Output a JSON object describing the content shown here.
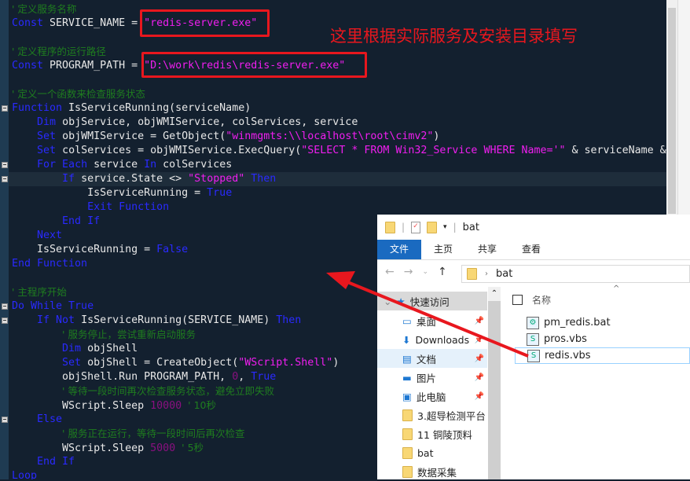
{
  "annotation": {
    "note": "这里根据实际服务及安装目录填写",
    "color": "#e8171e"
  },
  "code": [
    [
      [
        "cm",
        "' 定义服务名称"
      ]
    ],
    [
      [
        "kw",
        "Const"
      ],
      [
        "id",
        " SERVICE_NAME = "
      ],
      [
        "str",
        "\"redis-server.exe\""
      ]
    ],
    [],
    [
      [
        "cm",
        "' 定义程序的运行路径"
      ]
    ],
    [
      [
        "kw",
        "Const"
      ],
      [
        "id",
        " PROGRAM_PATH = "
      ],
      [
        "str",
        "\"D:\\work\\redis\\redis-server.exe\""
      ]
    ],
    [],
    [
      [
        "cm",
        "' 定义一个函数来检查服务状态"
      ]
    ],
    [
      [
        "kw",
        "Function"
      ],
      [
        "id",
        " IsServiceRunning(serviceName)"
      ]
    ],
    [
      [
        "id",
        "    "
      ],
      [
        "kw",
        "Dim"
      ],
      [
        "id",
        " objService, objWMIService, colServices, service"
      ]
    ],
    [
      [
        "id",
        "    "
      ],
      [
        "kw",
        "Set"
      ],
      [
        "id",
        " objWMIService = GetObject("
      ],
      [
        "str",
        "\"winmgmts:\\\\localhost\\root\\cimv2\""
      ],
      [
        "id",
        ")"
      ]
    ],
    [
      [
        "id",
        "    "
      ],
      [
        "kw",
        "Set"
      ],
      [
        "id",
        " colServices = objWMIService.ExecQuery("
      ],
      [
        "str",
        "\"SELECT * FROM Win32_Service WHERE Name='\""
      ],
      [
        "id",
        " & serviceName &"
      ]
    ],
    [
      [
        "id",
        "    "
      ],
      [
        "kw",
        "For Each"
      ],
      [
        "id",
        " service "
      ],
      [
        "kw",
        "In"
      ],
      [
        "id",
        " colServices"
      ]
    ],
    [
      [
        "id",
        "        "
      ],
      [
        "kw",
        "If"
      ],
      [
        "id",
        " service.State <> "
      ],
      [
        "str",
        "\"Stopped\""
      ],
      [
        "id",
        " "
      ],
      [
        "kw",
        "Then"
      ]
    ],
    [
      [
        "id",
        "            IsServiceRunning = "
      ],
      [
        "kw",
        "True"
      ]
    ],
    [
      [
        "id",
        "            "
      ],
      [
        "kw",
        "Exit Function"
      ]
    ],
    [
      [
        "id",
        "        "
      ],
      [
        "kw",
        "End If"
      ]
    ],
    [
      [
        "id",
        "    "
      ],
      [
        "kw",
        "Next"
      ]
    ],
    [
      [
        "id",
        "    IsServiceRunning = "
      ],
      [
        "kw",
        "False"
      ]
    ],
    [
      [
        "kw",
        "End Function"
      ]
    ],
    [],
    [
      [
        "cm",
        "' 主程序开始"
      ]
    ],
    [
      [
        "kw",
        "Do While True"
      ]
    ],
    [
      [
        "id",
        "    "
      ],
      [
        "kw",
        "If Not"
      ],
      [
        "id",
        " IsServiceRunning(SERVICE_NAME) "
      ],
      [
        "kw",
        "Then"
      ]
    ],
    [
      [
        "id",
        "        "
      ],
      [
        "cm",
        "' 服务停止，尝试重新启动服务"
      ]
    ],
    [
      [
        "id",
        "        "
      ],
      [
        "kw",
        "Dim"
      ],
      [
        "id",
        " objShell"
      ]
    ],
    [
      [
        "id",
        "        "
      ],
      [
        "kw",
        "Set"
      ],
      [
        "id",
        " objShell = CreateObject("
      ],
      [
        "str",
        "\"WScript.Shell\""
      ],
      [
        "id",
        ")"
      ]
    ],
    [
      [
        "id",
        "        objShell.Run PROGRAM_PATH, "
      ],
      [
        "num",
        "0"
      ],
      [
        "id",
        ", "
      ],
      [
        "kw",
        "True"
      ]
    ],
    [
      [
        "id",
        "        "
      ],
      [
        "cm",
        "' 等待一段时间再次检查服务状态，避免立即失败"
      ]
    ],
    [
      [
        "id",
        "        WScript.Sleep "
      ],
      [
        "num",
        "10000"
      ],
      [
        "id",
        " "
      ],
      [
        "cm",
        "' 10秒"
      ]
    ],
    [
      [
        "id",
        "    "
      ],
      [
        "kw",
        "Else"
      ]
    ],
    [
      [
        "id",
        "        "
      ],
      [
        "cm",
        "' 服务正在运行，等待一段时间后再次检查"
      ]
    ],
    [
      [
        "id",
        "        WScript.Sleep "
      ],
      [
        "num",
        "5000"
      ],
      [
        "id",
        " "
      ],
      [
        "cm",
        "' 5秒"
      ]
    ],
    [
      [
        "id",
        "    "
      ],
      [
        "kw",
        "End If"
      ]
    ],
    [
      [
        "kw",
        "Loop"
      ]
    ]
  ],
  "explorer": {
    "title": "bat",
    "ribbon_tabs": [
      "文件",
      "主页",
      "共享",
      "查看"
    ],
    "address": "bat",
    "nav": [
      {
        "label": "快速访问",
        "icon": "star-icon"
      },
      {
        "label": "桌面",
        "icon": "desktop-icon",
        "pinned": true
      },
      {
        "label": "Downloads",
        "icon": "download-icon",
        "pinned": true
      },
      {
        "label": "文档",
        "icon": "document-icon",
        "pinned": true,
        "selected": true
      },
      {
        "label": "图片",
        "icon": "picture-icon",
        "pinned": true
      },
      {
        "label": "此电脑",
        "icon": "computer-icon",
        "pinned": true
      },
      {
        "label": "3.超导检测平台",
        "icon": "folder-icon"
      },
      {
        "label": "11 铜陵顶料",
        "icon": "folder-icon"
      },
      {
        "label": "bat",
        "icon": "folder-icon"
      },
      {
        "label": "数据采集",
        "icon": "folder-icon"
      }
    ],
    "column_name": "名称",
    "files": [
      {
        "name": "pm_redis.bat",
        "icon": "bat-file-icon"
      },
      {
        "name": "pros.vbs",
        "icon": "vbs-file-icon"
      },
      {
        "name": "redis.vbs",
        "icon": "vbs-file-icon",
        "selected": true
      }
    ]
  }
}
